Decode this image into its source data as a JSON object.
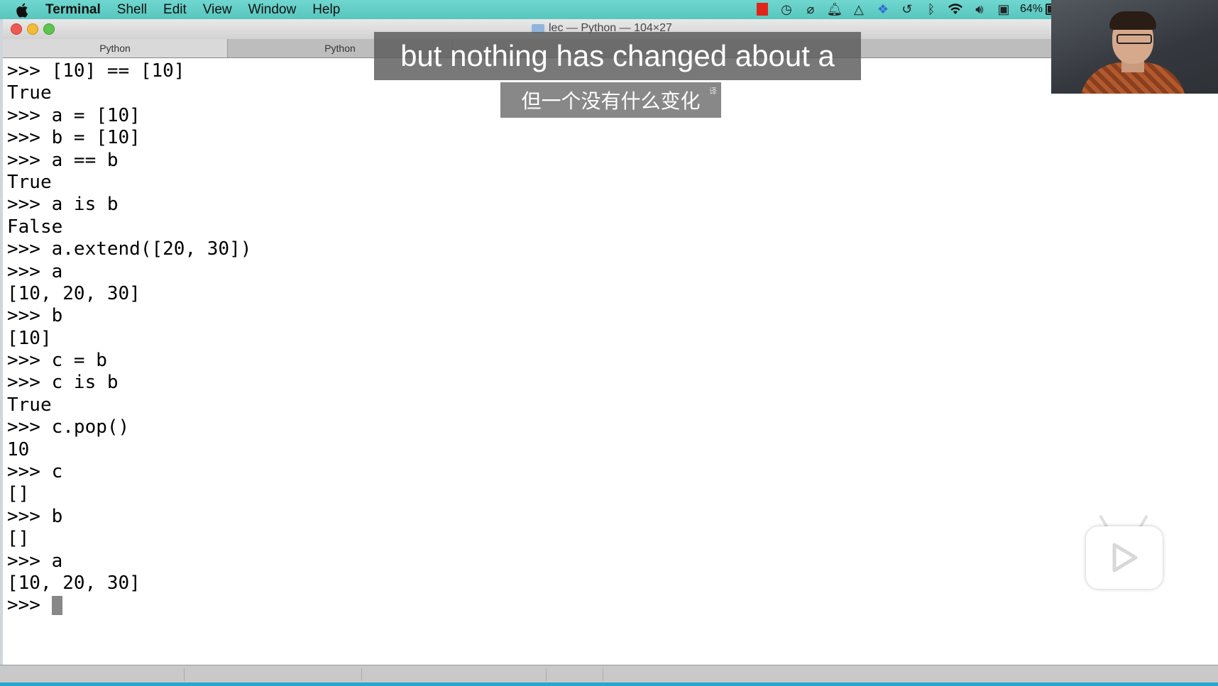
{
  "menubar": {
    "items": [
      "Terminal",
      "Shell",
      "Edit",
      "View",
      "Window",
      "Help"
    ],
    "battery_percent": "64%"
  },
  "window": {
    "title": "lec — Python — 104×27",
    "tabs": [
      "Python",
      "Python"
    ]
  },
  "terminal": {
    "lines": [
      ">>> [10] == [10]",
      "True",
      ">>> a = [10]",
      ">>> b = [10]",
      ">>> a == b",
      "True",
      ">>> a is b",
      "False",
      ">>> a.extend([20, 30])",
      ">>> a",
      "[10, 20, 30]",
      ">>> b",
      "[10]",
      ">>> c = b",
      ">>> c is b",
      "True",
      ">>> c.pop()",
      "10",
      ">>> c",
      "[]",
      ">>> b",
      "[]",
      ">>> a",
      "[10, 20, 30]"
    ],
    "prompt": ">>> "
  },
  "subtitles": {
    "english": "but nothing has changed about a",
    "chinese": "但一个没有什么变化",
    "chinese_tag": "译"
  },
  "colors": {
    "menubar": "#5fcdc4",
    "terminal_bg": "#ffffff",
    "subtitle_bg": "#5a5a5a"
  }
}
